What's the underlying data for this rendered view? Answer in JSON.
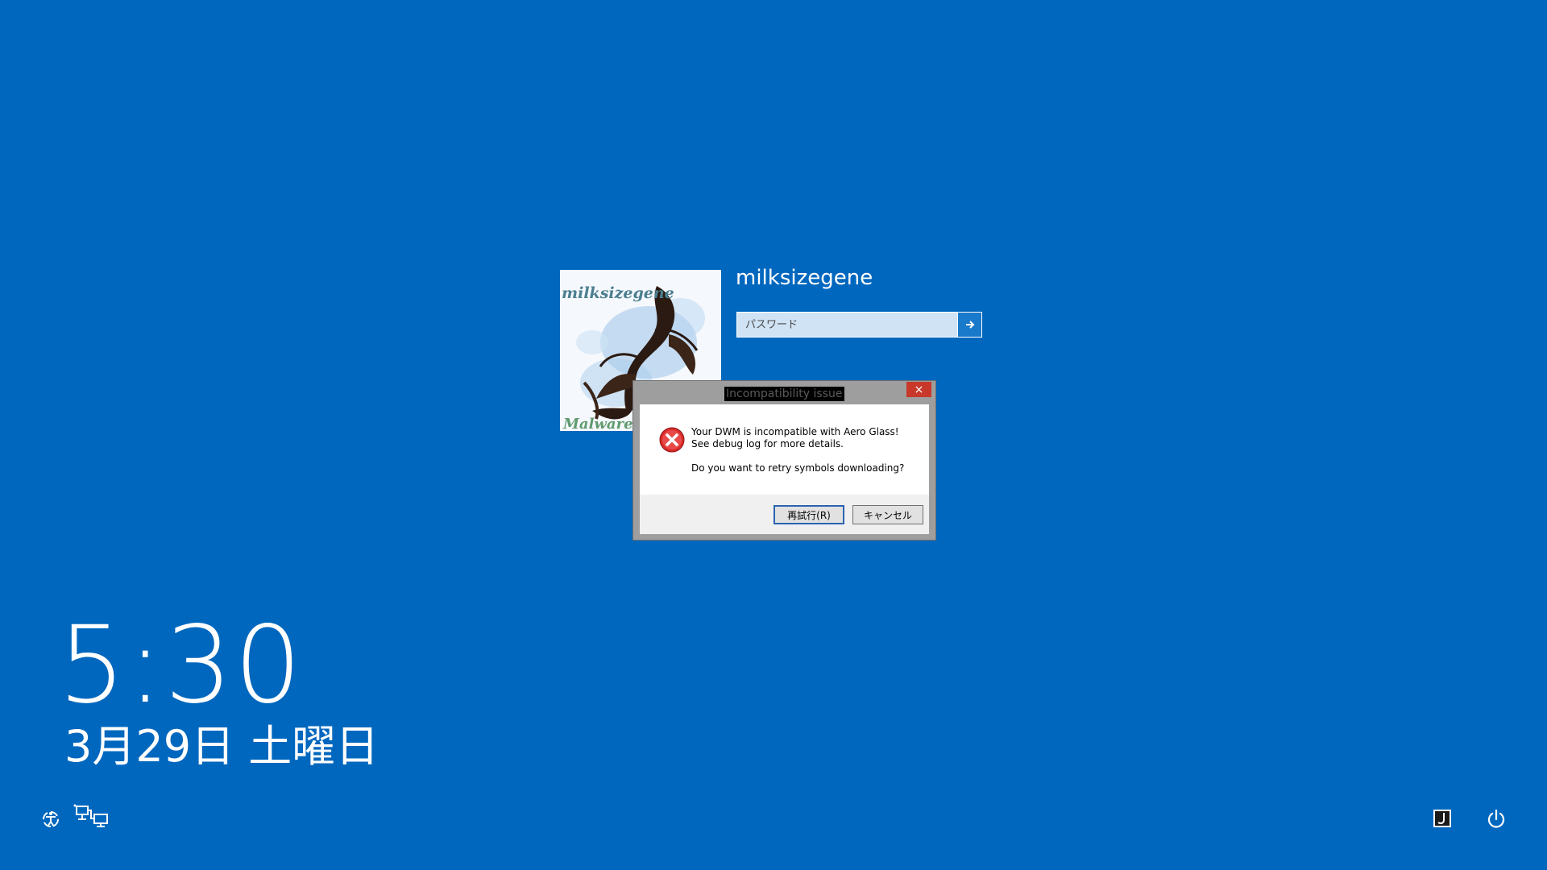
{
  "user": {
    "name": "milksizegene",
    "avatar_text_top": "milksizegene",
    "avatar_text_bottom": "Malware",
    "password_placeholder": "パスワード"
  },
  "dialog": {
    "title": "Incompatibility issue",
    "message_line1": "Your DWM is incompatible with Aero Glass!",
    "message_line2": "See debug log for more details.",
    "question": "Do you want to retry symbols downloading?",
    "retry_label": "再試行(R)",
    "cancel_label": "キャンセル",
    "close_glyph": "×"
  },
  "clock": {
    "time": "5:30",
    "date": "3月29日 土曜日"
  },
  "icons": {
    "ease_of_access": "ease-of-access-icon",
    "network": "network-icon",
    "ime": "ime-icon",
    "power": "power-icon",
    "submit": "arrow-right-icon",
    "error": "error-icon"
  },
  "colors": {
    "background": "#0067be",
    "close_button": "#c7382b",
    "error_red": "#d92b2b"
  }
}
